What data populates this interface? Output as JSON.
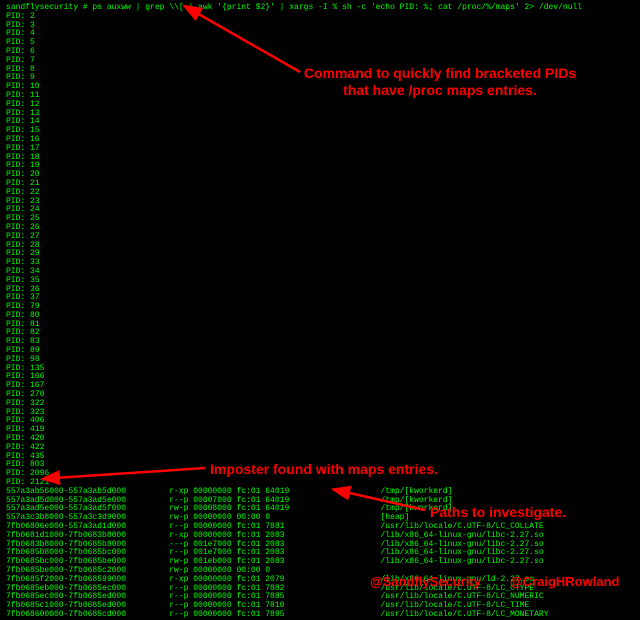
{
  "prompt": "sandflysecurity # ",
  "command": "ps auxww | grep \\\\[ | awk '{print $2}' | xargs -I % sh -c 'echo PID: %; cat /proc/%/maps' 2> /dev/null",
  "pids": [
    2,
    3,
    4,
    5,
    6,
    7,
    8,
    9,
    10,
    11,
    12,
    13,
    14,
    15,
    16,
    17,
    18,
    19,
    20,
    21,
    22,
    23,
    24,
    25,
    26,
    27,
    28,
    29,
    33,
    34,
    35,
    36,
    37,
    79,
    80,
    81,
    82,
    83,
    89,
    98,
    135,
    166,
    167,
    270,
    322,
    323,
    406,
    419,
    420,
    422,
    435,
    803,
    2096
  ],
  "suspect_pid": "PID: 2121",
  "maps": [
    {
      "range": "557a3ab56000-557a3ab5d000",
      "perm": "r-xp",
      "off": "00000000",
      "dev": "fc:01",
      "inode": "64019",
      "path": "/tmp/[kworkerd]"
    },
    {
      "range": "557a3ad5d000-557a3ad5e000",
      "perm": "r--p",
      "off": "00007000",
      "dev": "fc:01",
      "inode": "64019",
      "path": "/tmp/[kworkerd]"
    },
    {
      "range": "557a3ad5e000-557a3ad5f000",
      "perm": "rw-p",
      "off": "00008000",
      "dev": "fc:01",
      "inode": "64019",
      "path": "/tmp/[kworkerd]"
    },
    {
      "range": "557a3c3b8000-557a3c3d9000",
      "perm": "rw-p",
      "off": "00000000",
      "dev": "00:00",
      "inode": "0",
      "path": "[heap]"
    },
    {
      "range": "7fb06806e000-557a3ad1d000",
      "perm": "r--p",
      "off": "00000000",
      "dev": "fc:01",
      "inode": "7881",
      "path": "/usr/lib/locale/C.UTF-8/LC_COLLATE"
    },
    {
      "range": "7fb0681d1000-7fb0683b8000",
      "perm": "r-xp",
      "off": "00000000",
      "dev": "fc:01",
      "inode": "2083",
      "path": "/lib/x86_64-linux-gnu/libc-2.27.so"
    },
    {
      "range": "7fb0683b8000-7fb0685b8000",
      "perm": "---p",
      "off": "001e7000",
      "dev": "fc:01",
      "inode": "2083",
      "path": "/lib/x86_64-linux-gnu/libc-2.27.so"
    },
    {
      "range": "7fb0685b8000-7fb0685bc000",
      "perm": "r--p",
      "off": "001e7000",
      "dev": "fc:01",
      "inode": "2083",
      "path": "/lib/x86_64-linux-gnu/libc-2.27.so"
    },
    {
      "range": "7fb0685bc000-7fb0685be000",
      "perm": "rw-p",
      "off": "001eb000",
      "dev": "fc:01",
      "inode": "2083",
      "path": "/lib/x86_64-linux-gnu/libc-2.27.so"
    },
    {
      "range": "7fb0685be000-7fb0685c2000",
      "perm": "rw-p",
      "off": "00000000",
      "dev": "00:00",
      "inode": "0",
      "path": ""
    },
    {
      "range": "7fb0685f2000-7fb068599000",
      "perm": "r-xp",
      "off": "00000000",
      "dev": "fc:01",
      "inode": "2079",
      "path": "/lib/x86_64-linux-gnu/ld-2.27.so"
    },
    {
      "range": "7fb0685eb000-7fb0685ec000",
      "perm": "r--p",
      "off": "00000000",
      "dev": "fc:01",
      "inode": "7882",
      "path": "/usr/lib/locale/C.UTF-8/LC_CTYPE"
    },
    {
      "range": "7fb0685ec000-7fb0685ed000",
      "perm": "r--p",
      "off": "00000000",
      "dev": "fc:01",
      "inode": "7885",
      "path": "/usr/lib/locale/C.UTF-8/LC_NUMERIC"
    },
    {
      "range": "7fb0685c1000-7fb0685ed000",
      "perm": "r--p",
      "off": "00000000",
      "dev": "fc:01",
      "inode": "7810",
      "path": "/usr/lib/locale/C.UTF-8/LC_TIME"
    },
    {
      "range": "7fb068600000-7fb0685cd000",
      "perm": "r--p",
      "off": "00000000",
      "dev": "fc:01",
      "inode": "7895",
      "path": "/usr/lib/locale/C.UTF-8/LC_MONETARY"
    }
  ],
  "annot": {
    "top": "Command to quickly find bracketed PIDs\nthat have /proc maps entries.",
    "mid": "Imposter found with maps entries.",
    "right": "Paths to investigate."
  },
  "watermarks": {
    "left": "@SandflySecurity",
    "right": "@CraigHRowland"
  }
}
